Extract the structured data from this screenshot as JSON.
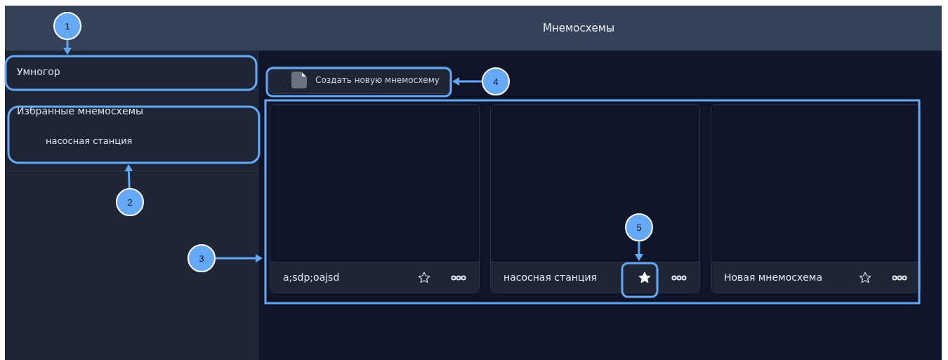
{
  "header": {
    "title": "Мнемосхемы"
  },
  "sidebar": {
    "project": "Умногор",
    "favorites": {
      "title": "Избранные мнемосхемы",
      "items": [
        {
          "label": "насосная станция"
        }
      ]
    }
  },
  "create_button": {
    "label": "Создать новую мнемосхему"
  },
  "cards": [
    {
      "name": "a;sdp;oajsd",
      "favorite": false
    },
    {
      "name": "насосная станция",
      "favorite": true
    },
    {
      "name": "Новая мнемосхема",
      "favorite": false
    }
  ],
  "annotations": [
    {
      "number": "1"
    },
    {
      "number": "2"
    },
    {
      "number": "3"
    },
    {
      "number": "4"
    },
    {
      "number": "5"
    }
  ]
}
